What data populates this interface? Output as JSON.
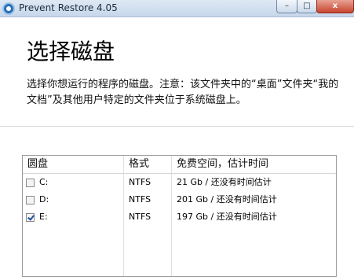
{
  "window": {
    "title": "Prevent Restore 4.05",
    "minimize": "–",
    "maximize": "□",
    "close": "x"
  },
  "page": {
    "heading": "选择磁盘",
    "description": "选择你想运行的程序的磁盘。注意：该文件夹中的“桌面”文件夹“我的文档”及其他用户特定的文件夹位于系统磁盘上。"
  },
  "table": {
    "headers": [
      "圆盘",
      "格式",
      "免费空间，估计时间"
    ],
    "rows": [
      {
        "drive": "C:",
        "format": "NTFS",
        "space": "21 Gb / 还没有时间估计",
        "checked": false
      },
      {
        "drive": "D:",
        "format": "NTFS",
        "space": "201 Gb / 还没有时间估计",
        "checked": false
      },
      {
        "drive": "E:",
        "format": "NTFS",
        "space": "197 Gb / 还没有时间估计",
        "checked": true
      }
    ]
  }
}
